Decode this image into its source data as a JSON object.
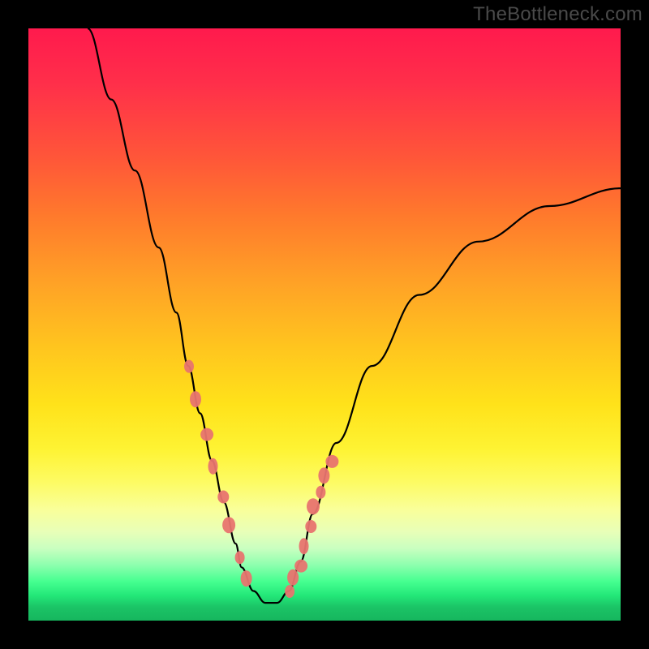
{
  "watermark": "TheBottleneck.com",
  "chart_data": {
    "type": "line",
    "title": "",
    "xlabel": "",
    "ylabel": "",
    "xlim": [
      0,
      100
    ],
    "ylim": [
      0,
      100
    ],
    "grid": false,
    "series": [
      {
        "name": "bottleneck-curve",
        "x": [
          10,
          14,
          18,
          22,
          25,
          27,
          29,
          31,
          33,
          35,
          36,
          38,
          40,
          42,
          44,
          46,
          48,
          52,
          58,
          66,
          76,
          88,
          100
        ],
        "values": [
          100,
          88,
          76,
          63,
          52,
          43,
          35,
          27,
          20,
          13,
          9,
          5,
          3,
          3,
          5,
          10,
          18,
          30,
          43,
          55,
          64,
          70,
          73
        ]
      }
    ],
    "highlight_clusters": [
      {
        "name": "left-cluster",
        "x_range": [
          27,
          37
        ],
        "count": 8
      },
      {
        "name": "right-cluster",
        "x_range": [
          44,
          51
        ],
        "count": 9
      }
    ],
    "background_gradient": {
      "top": "#ff1a4d",
      "mid": "#ffe21a",
      "bottom": "#16b65e"
    }
  }
}
